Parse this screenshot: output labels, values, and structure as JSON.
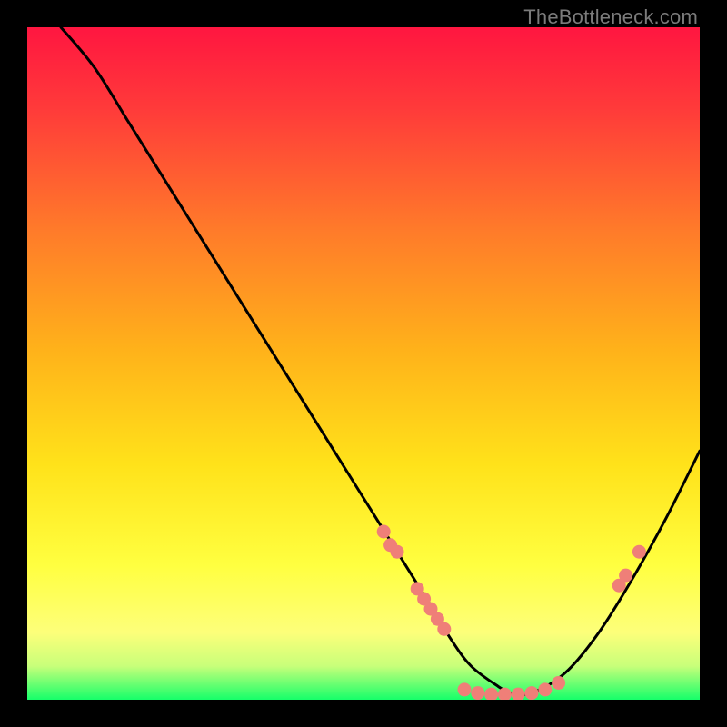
{
  "watermark": "TheBottleneck.com",
  "colors": {
    "background": "#000000",
    "gradient_top": "#ff1a3a",
    "gradient_mid1": "#ff6a2a",
    "gradient_mid2": "#ffd21a",
    "gradient_mid3": "#ffff55",
    "gradient_bottom": "#2aff6a",
    "curve": "#000000",
    "marker": "#ef7f78"
  },
  "chart_data": {
    "type": "line",
    "title": "",
    "xlabel": "",
    "ylabel": "",
    "xlim": [
      0,
      100
    ],
    "ylim": [
      0,
      100
    ],
    "grid": false,
    "legend": false,
    "series": [
      {
        "name": "curve",
        "x": [
          5,
          10,
          15,
          20,
          25,
          30,
          35,
          40,
          45,
          50,
          55,
          60,
          63,
          66,
          70,
          72,
          75,
          80,
          85,
          90,
          95,
          100
        ],
        "y": [
          100,
          94,
          86,
          78,
          70,
          62,
          54,
          46,
          38,
          30,
          22,
          14,
          9,
          5,
          2,
          1,
          1,
          4,
          10,
          18,
          27,
          37
        ]
      }
    ],
    "markers": [
      {
        "x": 53,
        "y": 25
      },
      {
        "x": 54,
        "y": 23
      },
      {
        "x": 55,
        "y": 22
      },
      {
        "x": 58,
        "y": 16.5
      },
      {
        "x": 59,
        "y": 15
      },
      {
        "x": 60,
        "y": 13.5
      },
      {
        "x": 61,
        "y": 12
      },
      {
        "x": 62,
        "y": 10.5
      },
      {
        "x": 65,
        "y": 1.5
      },
      {
        "x": 67,
        "y": 1
      },
      {
        "x": 69,
        "y": 0.8
      },
      {
        "x": 71,
        "y": 0.8
      },
      {
        "x": 73,
        "y": 0.8
      },
      {
        "x": 75,
        "y": 1
      },
      {
        "x": 77,
        "y": 1.5
      },
      {
        "x": 79,
        "y": 2.5
      },
      {
        "x": 88,
        "y": 17
      },
      {
        "x": 89,
        "y": 18.5
      },
      {
        "x": 91,
        "y": 22
      }
    ]
  }
}
